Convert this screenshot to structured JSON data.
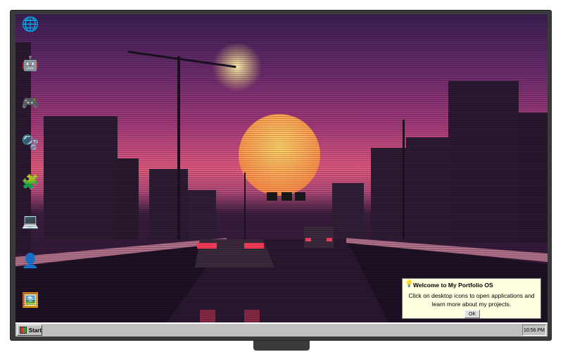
{
  "desktop": {
    "icons": [
      {
        "name": "globe-icon",
        "glyph": "🌐"
      },
      {
        "name": "robot-icon",
        "glyph": "🤖"
      },
      {
        "name": "gamepad-icon",
        "glyph": "🎮"
      },
      {
        "name": "bubbles-icon",
        "glyph": "🫧"
      },
      {
        "name": "puzzle-icon",
        "glyph": "🧩"
      },
      {
        "name": "laptop-icon",
        "glyph": "💻"
      },
      {
        "name": "user-icon",
        "glyph": "👤"
      },
      {
        "name": "picture-icon",
        "glyph": "🖼️"
      }
    ]
  },
  "popup": {
    "title": "Welcome to My Portfolio OS",
    "body": "Click on desktop icons to open applications and learn more about my projects.",
    "ok_label": "OK",
    "bulb_icon": "💡"
  },
  "taskbar": {
    "start_label": "Start",
    "clock": "10:56 PM"
  },
  "colors": {
    "taskbar": "#c0c0c0",
    "popup_bg": "#ffffe1",
    "sky_top": "#3b1f52",
    "sun": "#ffb347"
  }
}
